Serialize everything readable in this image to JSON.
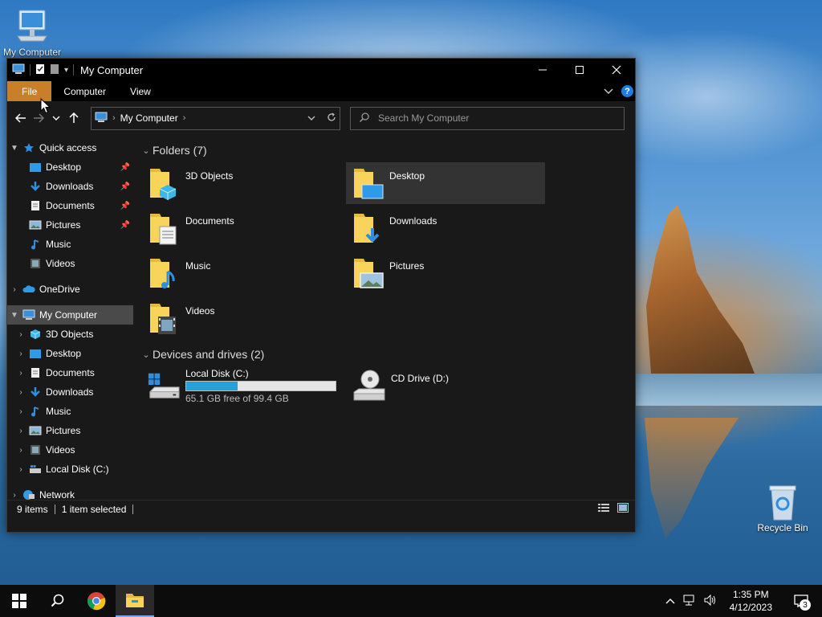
{
  "desktop": {
    "icons": [
      {
        "label": "My Computer",
        "icon": "computer-icon"
      },
      {
        "label": "Recycle Bin",
        "icon": "recycle-bin-icon"
      }
    ]
  },
  "window": {
    "title": "My Computer",
    "ribbon_tabs": [
      "File",
      "Computer",
      "View"
    ],
    "help_label": "?",
    "address": {
      "location": "My Computer"
    },
    "search": {
      "placeholder": "Search My Computer"
    }
  },
  "sidebar": {
    "quick_access": "Quick access",
    "quick_items": [
      "Desktop",
      "Downloads",
      "Documents",
      "Pictures",
      "Music",
      "Videos"
    ],
    "onedrive": "OneDrive",
    "my_computer": "My Computer",
    "pc_items": [
      "3D Objects",
      "Desktop",
      "Documents",
      "Downloads",
      "Music",
      "Pictures",
      "Videos",
      "Local Disk (C:)"
    ],
    "network": "Network"
  },
  "content": {
    "folders_header": "Folders (7)",
    "folders": [
      "3D Objects",
      "Desktop",
      "Documents",
      "Downloads",
      "Music",
      "Pictures",
      "Videos"
    ],
    "devices_header": "Devices and drives (2)",
    "drives": [
      {
        "name": "Local Disk (C:)",
        "free_text": "65.1 GB free of 99.4 GB",
        "used_fraction": 0.345
      },
      {
        "name": "CD Drive (D:)"
      }
    ]
  },
  "status": {
    "items": "9 items",
    "selected": "1 item selected"
  },
  "taskbar": {
    "time": "1:35 PM",
    "date": "4/12/2023",
    "notifications": "3"
  },
  "colors": {
    "accent_file_tab": "#c97f2a",
    "drive_bar": "#26a0da",
    "help_button": "#1f7fe0"
  }
}
